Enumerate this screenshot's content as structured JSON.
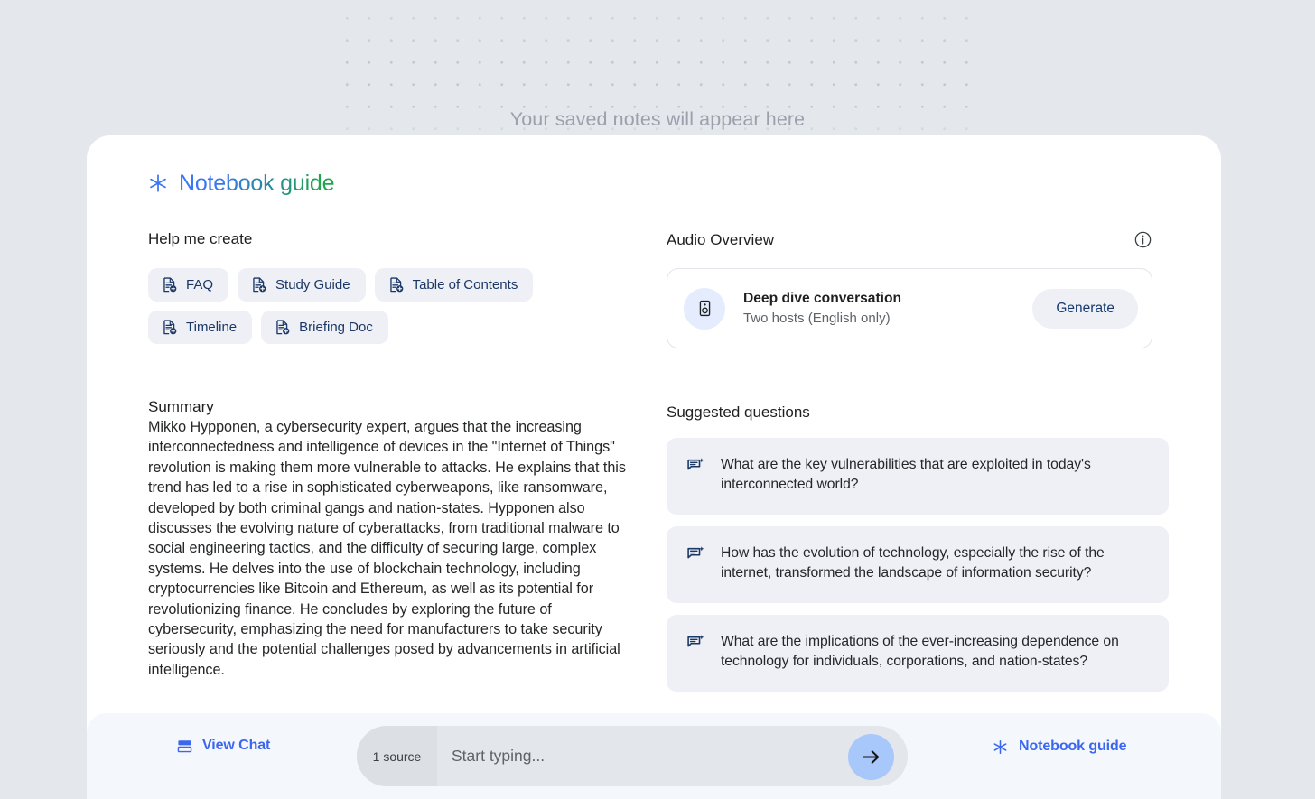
{
  "notes": {
    "placeholder": "Your saved notes will appear here"
  },
  "guide": {
    "title": "Notebook guide",
    "sparkle_icon": "sparkle-icon"
  },
  "help_me_create": {
    "heading": "Help me create",
    "chips": [
      {
        "label": "FAQ",
        "icon": "document-add-icon"
      },
      {
        "label": "Study Guide",
        "icon": "document-add-icon"
      },
      {
        "label": "Table of Contents",
        "icon": "document-add-icon"
      },
      {
        "label": "Timeline",
        "icon": "document-add-icon"
      },
      {
        "label": "Briefing Doc",
        "icon": "document-add-icon"
      }
    ]
  },
  "summary": {
    "heading": "Summary",
    "body": "Mikko Hypponen, a cybersecurity expert, argues that the increasing interconnectedness and intelligence of devices in the \"Internet of Things\" revolution is making them more vulnerable to attacks. He explains that this trend has led to a rise in sophisticated cyberweapons, like ransomware, developed by both criminal gangs and nation-states. Hypponen also discusses the evolving nature of cyberattacks, from traditional malware to social engineering tactics, and the difficulty of securing large, complex systems. He delves into the use of blockchain technology, including cryptocurrencies like Bitcoin and Ethereum, as well as its potential for revolutionizing finance. He concludes by exploring the future of cybersecurity, emphasizing the need for manufacturers to take security seriously and the potential challenges posed by advancements in artificial intelligence."
  },
  "audio_overview": {
    "heading": "Audio Overview",
    "info_icon": "info-icon",
    "card": {
      "icon": "speaker-icon",
      "title": "Deep dive conversation",
      "subtitle": "Two hosts (English only)",
      "button_label": "Generate"
    }
  },
  "suggested_questions": {
    "heading": "Suggested questions",
    "items": [
      {
        "icon": "chat-sparkle-icon",
        "text": "What are the key vulnerabilities that are exploited in today's interconnected world?"
      },
      {
        "icon": "chat-sparkle-icon",
        "text": "How has the evolution of technology, especially the rise of the internet, transformed the landscape of information security?"
      },
      {
        "icon": "chat-sparkle-icon",
        "text": "What are the implications of the ever-increasing dependence on technology for individuals, corporations, and nation-states?"
      }
    ]
  },
  "bottom_bar": {
    "view_chat": {
      "label": "View Chat",
      "icon": "split-layout-icon"
    },
    "source_count": "1 source",
    "input_placeholder": "Start typing...",
    "input_value": "",
    "send_icon": "arrow-right-icon",
    "notebook_guide": {
      "label": "Notebook guide",
      "icon": "sparkle-icon"
    }
  },
  "colors": {
    "page_bg": "#e4e8ed",
    "card_bg": "#ffffff",
    "chip_bg": "#eef0f5",
    "accent_blue": "#3a66f0",
    "title_gradient_start": "#3b76f6",
    "title_gradient_end": "#21a350",
    "navy_text": "#1b3766",
    "send_button_bg": "#a8c7fa",
    "bottom_bar_bg": "#f4f7fb"
  }
}
